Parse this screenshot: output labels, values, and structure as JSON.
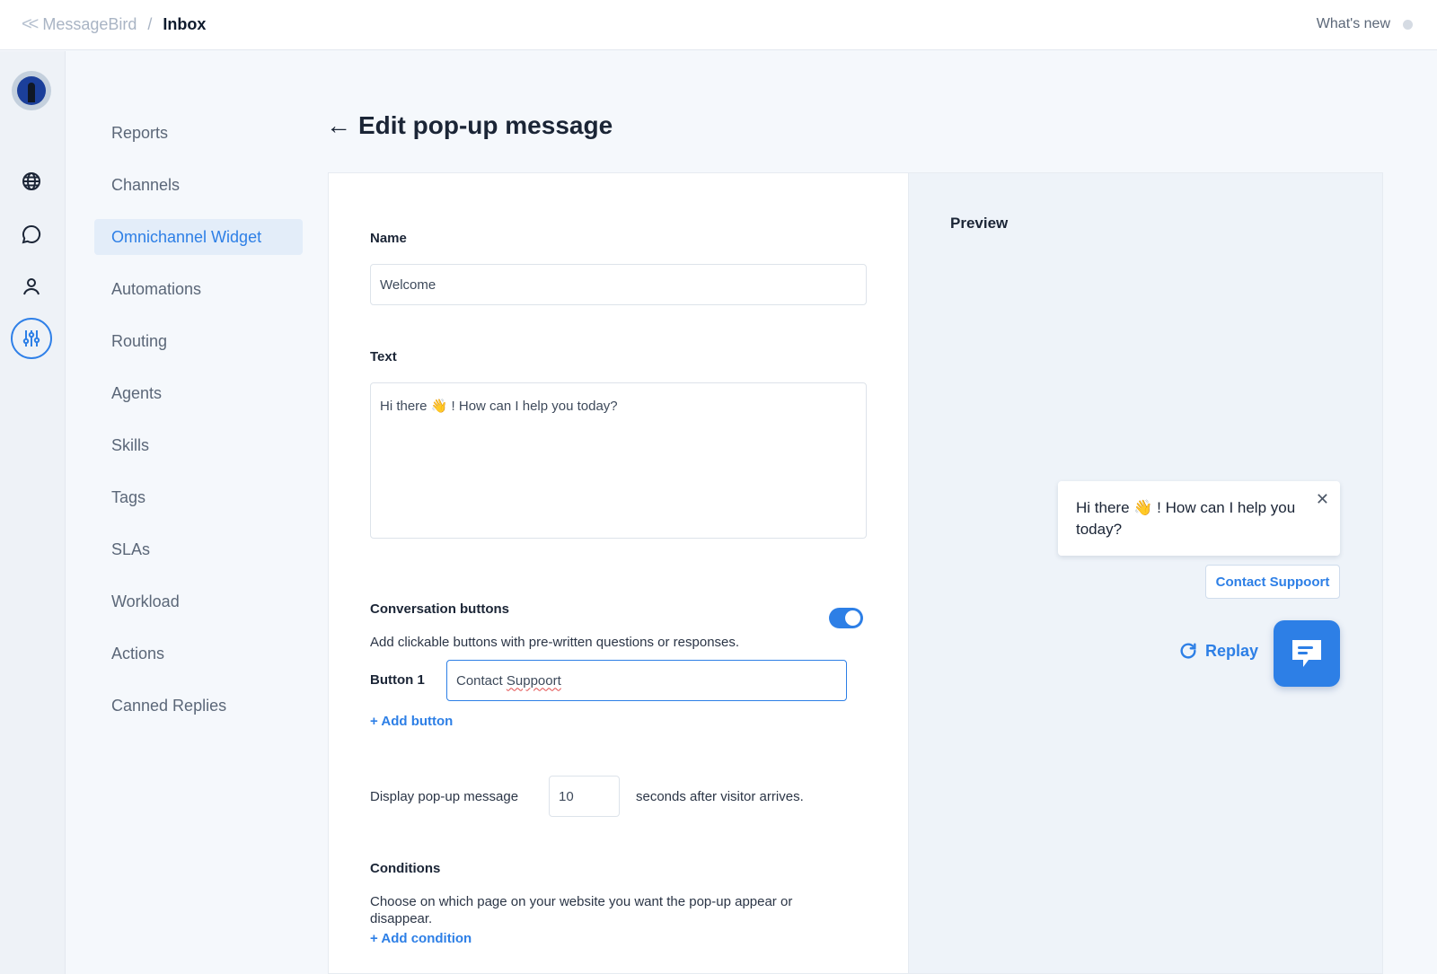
{
  "breadcrumb": {
    "app": "MessageBird",
    "separator": "/",
    "current": "Inbox"
  },
  "header": {
    "whats_new": "What's new"
  },
  "rail": {
    "icons": [
      "globe-icon",
      "chat-icon",
      "user-icon",
      "sliders-icon"
    ],
    "active": "sliders-icon"
  },
  "subnav": {
    "items": [
      {
        "label": "Reports"
      },
      {
        "label": "Channels"
      },
      {
        "label": "Omnichannel Widget",
        "active": true
      },
      {
        "label": "Automations"
      },
      {
        "label": "Routing"
      },
      {
        "label": "Agents"
      },
      {
        "label": "Skills"
      },
      {
        "label": "Tags"
      },
      {
        "label": "SLAs"
      },
      {
        "label": "Workload"
      },
      {
        "label": "Actions"
      },
      {
        "label": "Canned Replies"
      }
    ]
  },
  "page": {
    "back_icon": "←",
    "title": "Edit pop-up message"
  },
  "form": {
    "name_label": "Name",
    "name_value": "Welcome",
    "text_label": "Text",
    "text_value": "Hi there 👋 ! How can I help you today?",
    "conversation_label": "Conversation buttons",
    "conversation_enabled": true,
    "conversation_help": "Add clickable buttons with pre-written questions or responses.",
    "button1_label": "Button 1",
    "button1_value_prefix": "Contact ",
    "button1_value_word": "Suppoort",
    "add_button": "+ Add button",
    "display_prefix": "Display pop-up message",
    "display_seconds": "10",
    "display_suffix": "seconds after visitor arrives.",
    "conditions_label": "Conditions",
    "conditions_help": "Choose on which page on your website you want the pop-up appear or disappear.",
    "add_condition": "+ Add condition"
  },
  "preview": {
    "title": "Preview",
    "bubble_text": "Hi there 👋 ! How can I help you today?",
    "close": "✕",
    "contact_button": "Contact Suppoort",
    "replay": "Replay"
  },
  "colors": {
    "accent": "#2d7fe6",
    "background": "#f5f8fc",
    "rail": "#eef2f7",
    "active_nav": "#e3edf9"
  }
}
